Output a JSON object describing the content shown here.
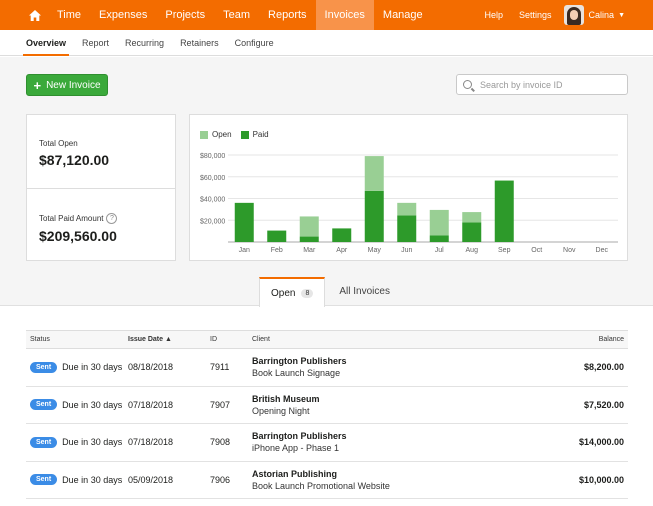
{
  "nav": {
    "items": [
      {
        "label": "Time",
        "active": false
      },
      {
        "label": "Expenses",
        "active": false
      },
      {
        "label": "Projects",
        "active": false
      },
      {
        "label": "Team",
        "active": false
      },
      {
        "label": "Reports",
        "active": false
      },
      {
        "label": "Invoices",
        "active": true
      },
      {
        "label": "Manage",
        "active": false
      }
    ],
    "help": "Help",
    "settings": "Settings",
    "user": "Calina"
  },
  "subnav": {
    "items": [
      {
        "label": "Overview",
        "active": true
      },
      {
        "label": "Report",
        "active": false
      },
      {
        "label": "Recurring",
        "active": false
      },
      {
        "label": "Retainers",
        "active": false
      },
      {
        "label": "Configure",
        "active": false
      }
    ]
  },
  "toolbar": {
    "new_invoice": "New Invoice",
    "search_placeholder": "Search by invoice ID"
  },
  "summary": {
    "total_open_label": "Total Open",
    "total_open_value": "$87,120.00",
    "total_paid_label": "Total Paid Amount",
    "total_paid_value": "$209,560.00"
  },
  "colors": {
    "accent": "#f36c00",
    "open": "#99cf94",
    "paid": "#2d9a2a",
    "badge": "#3b8ce6"
  },
  "chart_data": {
    "type": "bar",
    "stacked": true,
    "categories": [
      "Jan",
      "Feb",
      "Mar",
      "Apr",
      "May",
      "Jun",
      "Jul",
      "Aug",
      "Sep",
      "Oct",
      "Nov",
      "Dec"
    ],
    "series": [
      {
        "name": "Paid",
        "values": [
          36000,
          10500,
          5000,
          12500,
          47000,
          24500,
          6000,
          18000,
          56500,
          0,
          0,
          0
        ]
      },
      {
        "name": "Open",
        "values": [
          0,
          0,
          18500,
          0,
          32000,
          11500,
          23500,
          9500,
          0,
          0,
          0,
          0
        ]
      }
    ],
    "yticks": [
      "$20,000",
      "$40,000",
      "$60,000",
      "$80,000"
    ],
    "ylim": [
      0,
      80000
    ],
    "grid": true,
    "legend": "top-left"
  },
  "tabs": [
    {
      "label": "Open",
      "count": "8",
      "active": true
    },
    {
      "label": "All Invoices",
      "count": "",
      "active": false
    }
  ],
  "table": {
    "headers": {
      "status": "Status",
      "date": "Issue Date",
      "id": "ID",
      "client": "Client",
      "balance": "Balance"
    },
    "rows": [
      {
        "badge": "Sent",
        "status": "Due in 30 days",
        "date": "08/18/2018",
        "id": "7911",
        "client": "Barrington Publishers",
        "project": "Book Launch Signage",
        "balance": "$8,200.00"
      },
      {
        "badge": "Sent",
        "status": "Due in 30 days",
        "date": "07/18/2018",
        "id": "7907",
        "client": "British Museum",
        "project": "Opening Night",
        "balance": "$7,520.00"
      },
      {
        "badge": "Sent",
        "status": "Due in 30 days",
        "date": "07/18/2018",
        "id": "7908",
        "client": "Barrington Publishers",
        "project": "iPhone App - Phase 1",
        "balance": "$14,000.00"
      },
      {
        "badge": "Sent",
        "status": "Due in 30 days",
        "date": "05/09/2018",
        "id": "7906",
        "client": "Astorian Publishing",
        "project": "Book Launch Promotional Website",
        "balance": "$10,000.00"
      }
    ]
  }
}
